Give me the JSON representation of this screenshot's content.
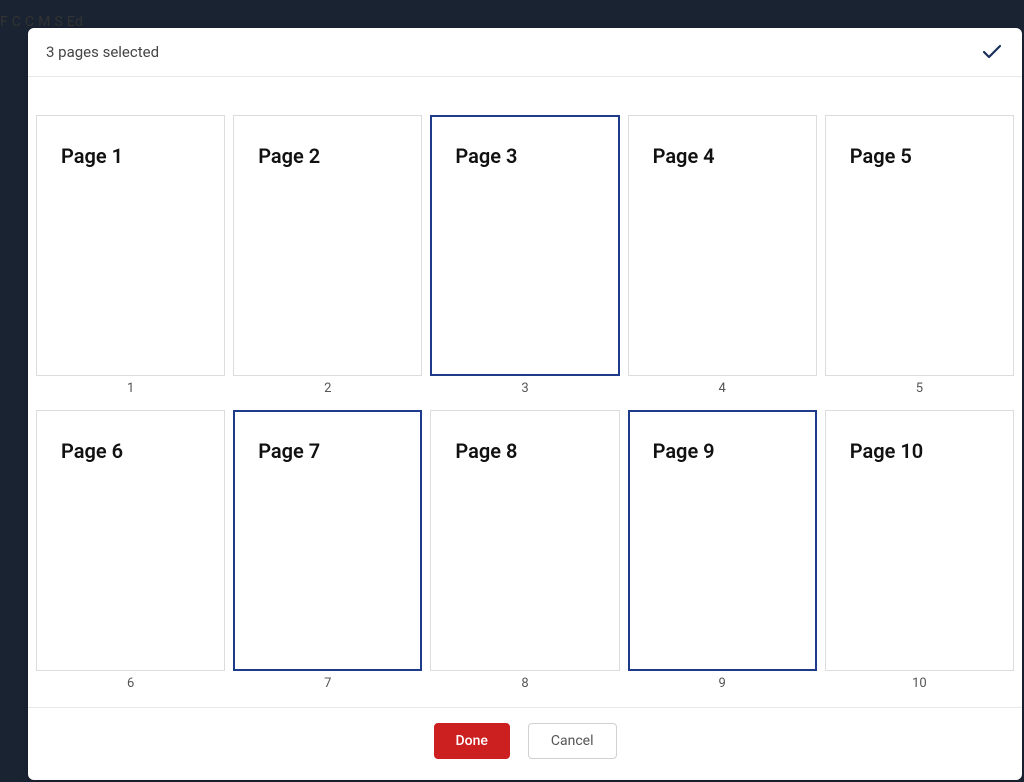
{
  "background_text": "F C                C                    M            S          Ed",
  "header": {
    "title": "3 pages selected"
  },
  "pages": [
    {
      "label": "Page 1",
      "number": "1",
      "selected": false
    },
    {
      "label": "Page 2",
      "number": "2",
      "selected": false
    },
    {
      "label": "Page 3",
      "number": "3",
      "selected": true
    },
    {
      "label": "Page 4",
      "number": "4",
      "selected": false
    },
    {
      "label": "Page 5",
      "number": "5",
      "selected": false
    },
    {
      "label": "Page 6",
      "number": "6",
      "selected": false
    },
    {
      "label": "Page 7",
      "number": "7",
      "selected": true
    },
    {
      "label": "Page 8",
      "number": "8",
      "selected": false
    },
    {
      "label": "Page 9",
      "number": "9",
      "selected": true
    },
    {
      "label": "Page 10",
      "number": "10",
      "selected": false
    }
  ],
  "footer": {
    "done_label": "Done",
    "cancel_label": "Cancel"
  }
}
